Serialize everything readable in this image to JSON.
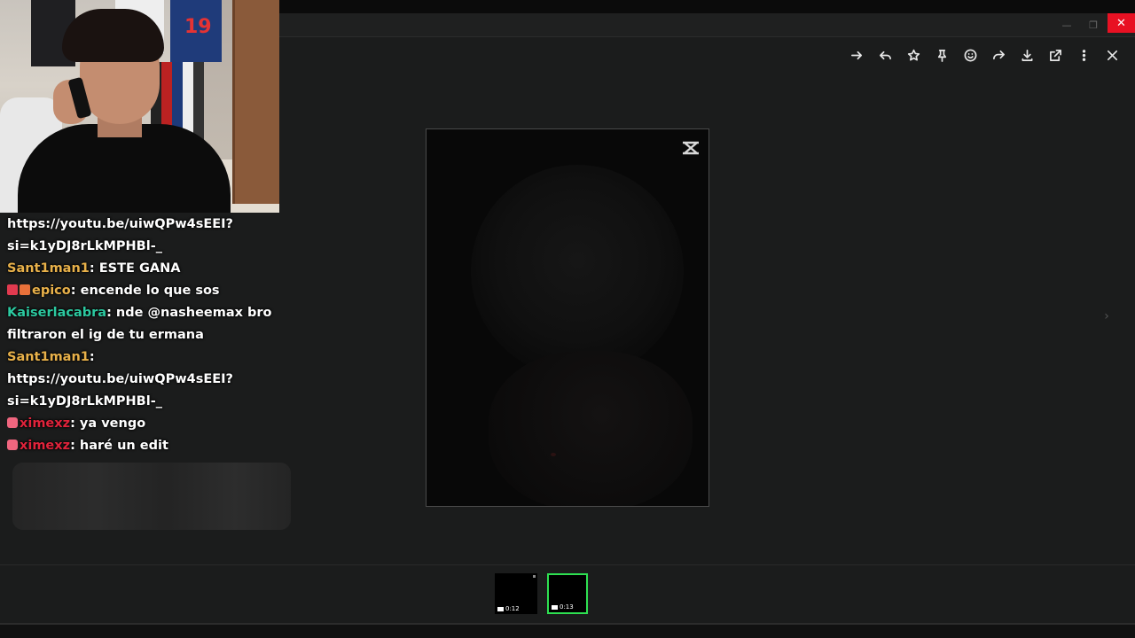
{
  "window": {
    "minimize_icon": "minimize-icon",
    "restore_icon": "restore-icon",
    "close_icon": "close-icon",
    "close_color": "#e81123"
  },
  "toolbar": {
    "icons": [
      "forward-arrow-icon",
      "reply-icon",
      "star-icon",
      "pin-icon",
      "emoji-icon",
      "share-icon",
      "download-icon",
      "open-external-icon",
      "more-icon",
      "close-icon"
    ]
  },
  "media": {
    "watermark_icon": "capcut-icon",
    "next_icon": "chevron-right-icon"
  },
  "thumbnails": [
    {
      "duration": "0:12",
      "selected": false
    },
    {
      "duration": "0:13",
      "selected": true,
      "border_color": "#2ee051"
    }
  ],
  "chat": {
    "lines": [
      {
        "user": "",
        "text": "https://youtu.be/uiwQPw4sEEI?"
      },
      {
        "user": "",
        "text": "si=k1yDJ8rLkMPHBl-_"
      },
      {
        "user": "Sant1man1",
        "sep": ": ",
        "text": "ESTE GANA"
      },
      {
        "user": "epico",
        "sep": ": ",
        "text": "encende lo que sos"
      },
      {
        "user": "Kaiserlacabra",
        "sep": ": ",
        "text": "nde @nasheemax bro"
      },
      {
        "user": "",
        "text": "filtraron el ig de tu ermana"
      },
      {
        "user": "Sant1man1",
        "sep": ":",
        "text": ""
      },
      {
        "user": "",
        "text": "https://youtu.be/uiwQPw4sEEI?"
      },
      {
        "user": "",
        "text": "si=k1yDJ8rLkMPHBl-_"
      },
      {
        "user": "ximexz",
        "sep": ": ",
        "text": "ya vengo"
      },
      {
        "user": "ximexz",
        "sep": ": ",
        "text": "haré un edit"
      }
    ],
    "colors": {
      "gold": "#e8b14a",
      "teal": "#2cc9a0",
      "red": "#e0233b"
    }
  },
  "webcam": {
    "jersey_number": "19"
  }
}
